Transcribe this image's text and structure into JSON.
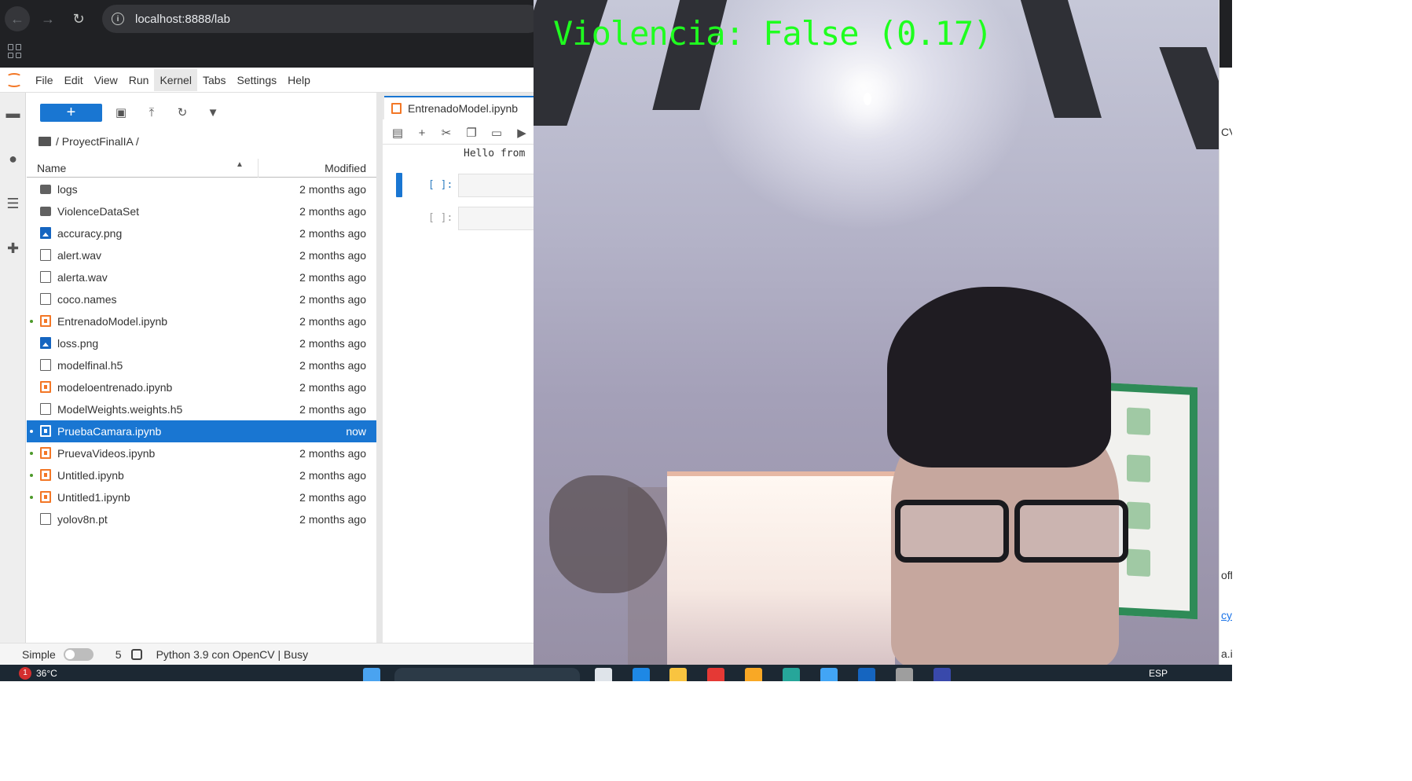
{
  "browser": {
    "url": "localhost:8888/lab"
  },
  "menubar": {
    "items": [
      "File",
      "Edit",
      "View",
      "Run",
      "Kernel",
      "Tabs",
      "Settings",
      "Help"
    ],
    "active_item": "Kernel"
  },
  "filebrowser": {
    "new_button_label": "+",
    "breadcrumb": "/ ProyectFinalIA /",
    "columns": {
      "name": "Name",
      "modified": "Modified"
    },
    "files": [
      {
        "name": "logs",
        "type": "folder",
        "modified": "2 months ago",
        "running": false,
        "selected": false
      },
      {
        "name": "ViolenceDataSet",
        "type": "folder",
        "modified": "2 months ago",
        "running": false,
        "selected": false
      },
      {
        "name": "accuracy.png",
        "type": "image",
        "modified": "2 months ago",
        "running": false,
        "selected": false
      },
      {
        "name": "alert.wav",
        "type": "text",
        "modified": "2 months ago",
        "running": false,
        "selected": false
      },
      {
        "name": "alerta.wav",
        "type": "text",
        "modified": "2 months ago",
        "running": false,
        "selected": false
      },
      {
        "name": "coco.names",
        "type": "text",
        "modified": "2 months ago",
        "running": false,
        "selected": false
      },
      {
        "name": "EntrenadoModel.ipynb",
        "type": "notebook",
        "modified": "2 months ago",
        "running": true,
        "selected": false
      },
      {
        "name": "loss.png",
        "type": "image",
        "modified": "2 months ago",
        "running": false,
        "selected": false
      },
      {
        "name": "modelfinal.h5",
        "type": "text",
        "modified": "2 months ago",
        "running": false,
        "selected": false
      },
      {
        "name": "modeloentrenado.ipynb",
        "type": "notebook",
        "modified": "2 months ago",
        "running": false,
        "selected": false
      },
      {
        "name": "ModelWeights.weights.h5",
        "type": "text",
        "modified": "2 months ago",
        "running": false,
        "selected": false
      },
      {
        "name": "PruebaCamara.ipynb",
        "type": "notebook",
        "modified": "now",
        "running": true,
        "selected": true
      },
      {
        "name": "PruevaVideos.ipynb",
        "type": "notebook",
        "modified": "2 months ago",
        "running": true,
        "selected": false
      },
      {
        "name": "Untitled.ipynb",
        "type": "notebook",
        "modified": "2 months ago",
        "running": true,
        "selected": false
      },
      {
        "name": "Untitled1.ipynb",
        "type": "notebook",
        "modified": "2 months ago",
        "running": true,
        "selected": false
      },
      {
        "name": "yolov8n.pt",
        "type": "text",
        "modified": "2 months ago",
        "running": false,
        "selected": false
      }
    ]
  },
  "notebook": {
    "tab_title": "EntrenadoModel.ipynb",
    "output_text": "Hello from",
    "cells": [
      {
        "prompt": "[ ]:",
        "active": true
      },
      {
        "prompt": "[ ]:",
        "active": false
      }
    ]
  },
  "statusbar": {
    "mode": "Simple",
    "count": "5",
    "kernel": "Python 3.9 con OpenCV | Busy"
  },
  "camera_window": {
    "overlay_text": "Violencia: False (0.17)",
    "overlay_color": "#1fff1f"
  },
  "right_edge": {
    "frag_cv": "CV",
    "frag_off": "off",
    "frag_cy": "cy",
    "frag_ai": "a.i"
  },
  "taskbar": {
    "weather_badge": "1",
    "temperature": "36°C",
    "language": "ESP"
  },
  "colors": {
    "accent": "#1976d2",
    "notebook_orange": "#f37726",
    "running_dot": "#4c9a2a"
  }
}
